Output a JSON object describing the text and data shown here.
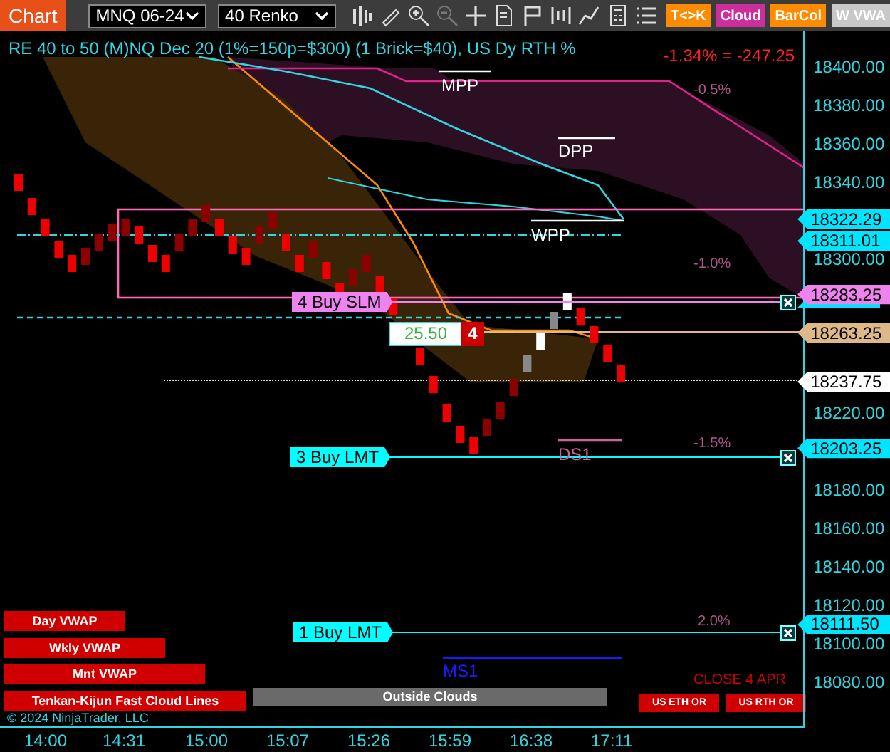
{
  "toolbar": {
    "tab": "Chart",
    "instrument": "MNQ 06-24",
    "bar_type": "40 Renko",
    "buttons": [
      {
        "label": "T<>K",
        "color": "#ff8c00"
      },
      {
        "label": "Cloud",
        "color": "#cc2e9e"
      },
      {
        "label": "BarCol",
        "color": "#ff8c00"
      },
      {
        "label": "W VWA",
        "color": "#c8c8c8"
      }
    ]
  },
  "chart": {
    "legend": "RE 40 to 50 (M)NQ Dec 20 (1%=150p=$300) (1 Brick=$40), US Dy RTH %",
    "pnl": "-1.34% = -247.25",
    "levels": [
      {
        "label": "MPP",
        "color": "#ffffff"
      },
      {
        "label": "DPP",
        "color": "#ffffff"
      },
      {
        "label": "WPP",
        "color": "#ffffff"
      },
      {
        "label": "DS1",
        "color": "#d060a0"
      },
      {
        "label": "MS1",
        "color": "#1a1aff"
      }
    ],
    "percent_labels": [
      "-0.5%",
      "-1.0%",
      "-1.5%",
      "2.0%"
    ],
    "orders": [
      {
        "label": "4 Buy SLM",
        "color": "#ee82ee"
      },
      {
        "label": "3 Buy LMT",
        "color": "#00ffff"
      },
      {
        "label": "1 Buy LMT",
        "color": "#00ffff"
      }
    ],
    "position": {
      "pnl": "25.50",
      "quantity": "4"
    },
    "indicator_buttons": [
      "Day VWAP",
      "Wkly VWAP",
      "Mnt VWAP",
      "Tenkan-Kijun Fast Cloud Lines"
    ],
    "outside_clouds": "Outside Clouds",
    "session_buttons": [
      "US ETH OR",
      "US RTH OR"
    ],
    "close_label": "CLOSE 4 APR",
    "copyright": "© 2024 NinjaTrader, LLC"
  },
  "price_axis": {
    "ticks": [
      "18400.00",
      "18380.00",
      "18360.00",
      "18340.00",
      "18300.00",
      "18220.00",
      "18180.00",
      "18160.00",
      "18140.00",
      "18120.00",
      "18100.00",
      "18080.00"
    ],
    "markers": [
      {
        "price": "18322.29",
        "color": "#00e5ff"
      },
      {
        "price": "18311.01",
        "color": "#00e5ff"
      },
      {
        "price": "18283.25",
        "color": "#ee82ee"
      },
      {
        "price": "18263.25",
        "color": "#deb887"
      },
      {
        "price": "18237.75",
        "color": "#ffffff"
      },
      {
        "price": "18203.25",
        "color": "#00e5ff"
      },
      {
        "price": "18111.50",
        "color": "#00e5ff"
      }
    ]
  },
  "time_axis": [
    "14:00",
    "14:31",
    "15:00",
    "15:07",
    "15:26",
    "15:59",
    "16:38",
    "17:11"
  ]
}
